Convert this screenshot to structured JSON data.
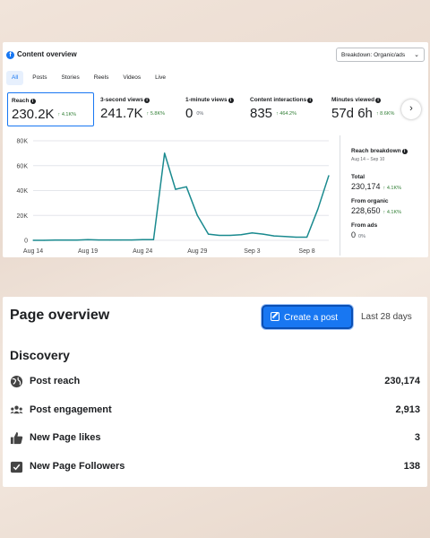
{
  "content_overview": {
    "title": "Content overview",
    "breakdown_label": "Breakdown: Organic/ads",
    "tabs": [
      "All",
      "Posts",
      "Stories",
      "Reels",
      "Videos",
      "Live"
    ],
    "active_tab": "All",
    "metrics": [
      {
        "label": "Reach",
        "value": "230.2K",
        "change": "↑ 4.1K%",
        "direction": "up"
      },
      {
        "label": "3-second views",
        "value": "241.7K",
        "change": "↑ 5.8K%",
        "direction": "up"
      },
      {
        "label": "1-minute views",
        "value": "0",
        "change": "0%",
        "direction": "neutral"
      },
      {
        "label": "Content interactions",
        "value": "835",
        "change": "↑ 464.2%",
        "direction": "up"
      },
      {
        "label": "Minutes viewed",
        "value": "57d 6h",
        "change": "↑ 8.6K%",
        "direction": "up"
      }
    ],
    "reach_breakdown": {
      "title": "Reach breakdown",
      "date_range": "Aug 14 – Sep 10",
      "rows": [
        {
          "label": "Total",
          "value": "230,174",
          "change": "↑ 4.1K%",
          "direction": "up"
        },
        {
          "label": "From organic",
          "value": "228,650",
          "change": "↑ 4.1K%",
          "direction": "up"
        },
        {
          "label": "From ads",
          "value": "0",
          "change": "0%",
          "direction": "neutral"
        }
      ]
    }
  },
  "chart_data": {
    "type": "line",
    "x_tick_labels": [
      "Aug 14",
      "Aug 19",
      "Aug 24",
      "Aug 29",
      "Sep 3",
      "Sep 8"
    ],
    "y_tick_labels": [
      "0",
      "20K",
      "40K",
      "60K",
      "80K"
    ],
    "ylim": [
      0,
      80000
    ],
    "xlim": [
      "Aug 14",
      "Sep 10"
    ],
    "grid": true,
    "color": "#1a8a8f",
    "series": [
      {
        "x": [
          "Aug 14",
          "Aug 15",
          "Aug 16",
          "Aug 17",
          "Aug 18",
          "Aug 19",
          "Aug 20",
          "Aug 21",
          "Aug 22",
          "Aug 23",
          "Aug 24",
          "Aug 25",
          "Aug 26",
          "Aug 27",
          "Aug 28",
          "Aug 29",
          "Aug 30",
          "Aug 31",
          "Sep 1",
          "Sep 2",
          "Sep 3",
          "Sep 4",
          "Sep 5",
          "Sep 6",
          "Sep 7",
          "Sep 8",
          "Sep 9",
          "Sep 10"
        ],
        "y": [
          0,
          0,
          200,
          200,
          200,
          500,
          300,
          300,
          300,
          300,
          500,
          500,
          70000,
          41000,
          43000,
          20000,
          5000,
          4000,
          4000,
          4500,
          6000,
          5000,
          3500,
          3000,
          2500,
          2500,
          25000,
          52000
        ]
      }
    ]
  },
  "page_overview": {
    "title": "Page overview",
    "create_button": "Create a post",
    "period": "Last 28 days",
    "section": "Discovery",
    "rows": [
      {
        "icon": "globe-icon",
        "label": "Post reach",
        "value": "230,174"
      },
      {
        "icon": "people-icon",
        "label": "Post engagement",
        "value": "2,913"
      },
      {
        "icon": "thumbs-up-icon",
        "label": "New Page likes",
        "value": "3"
      },
      {
        "icon": "follow-check-icon",
        "label": "New Page Followers",
        "value": "138"
      }
    ]
  }
}
